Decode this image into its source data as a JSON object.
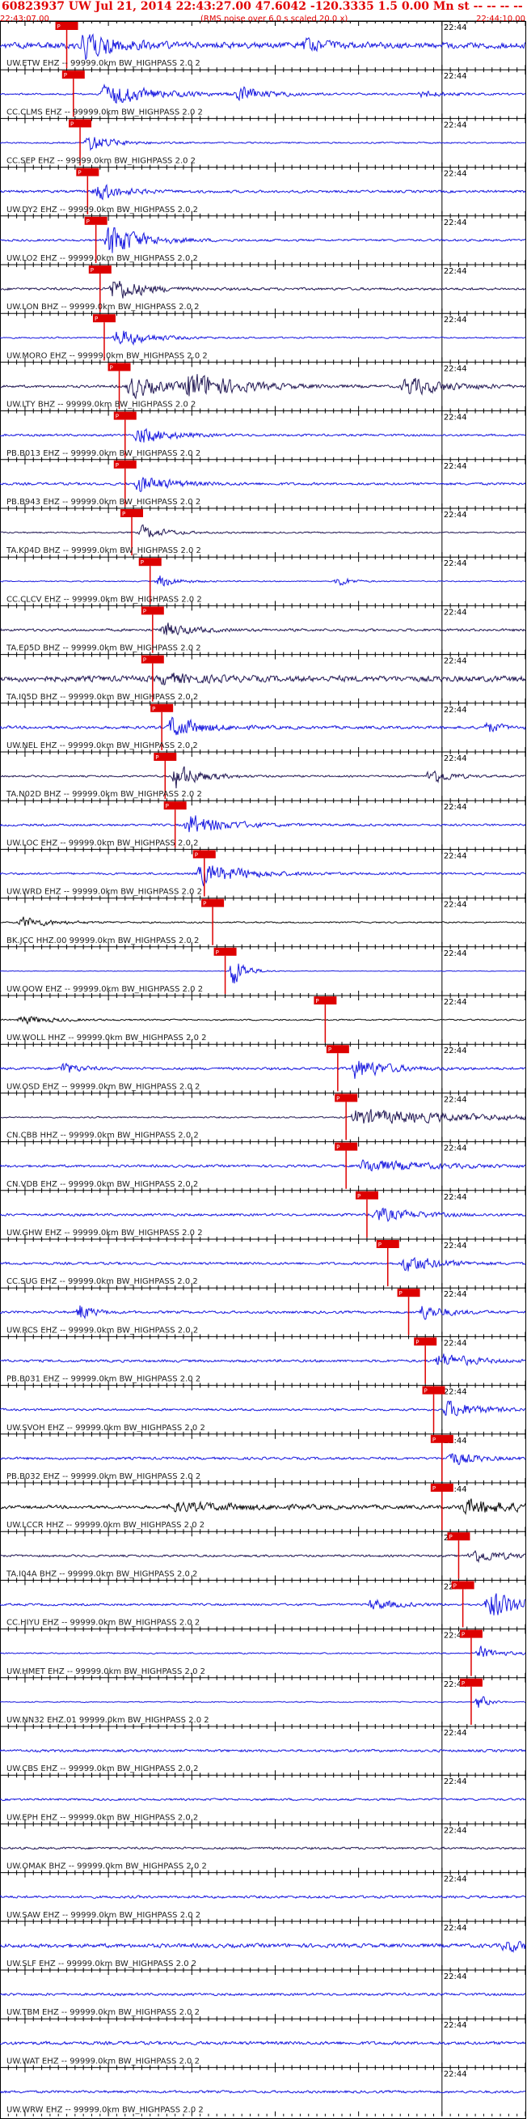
{
  "header": {
    "title": "60823937 UW Jul 21, 2014 22:43:27.00   47.6042 -120.3335  1.5 0.00 Mn st -- -- -- --",
    "start_time": "22:43:07.00",
    "note": "(RMS noise over 6.0 s scaled 20.0 x)",
    "end_time": "22:44:10.00"
  },
  "colors": {
    "header": "#e00000",
    "pick": "#dd0000",
    "blue": "#1a1adf",
    "black": "#111111",
    "navy": "#241a55"
  },
  "chart_data": {
    "type": "line",
    "title": "60823937 UW Jul 21, 2014 22:43:27.00   47.6042 -120.3335  1.5 0.00 Mn st -- -- -- --",
    "x_range_seconds": [
      0,
      63
    ],
    "time_marker": {
      "label": "22:44",
      "seconds": 53
    },
    "traces": [
      {
        "label": "UW.ETW EHZ -- 99999.0km BW_HIGHPASS  2.0  2",
        "color": "blue",
        "amp": 0.85,
        "pick": "P",
        "pick_seconds": 8.0,
        "events": [
          [
            9.5,
            4.5,
            9,
            10
          ],
          [
            36,
            1.2,
            7,
            4
          ]
        ]
      },
      {
        "label": "CC.CLMS EHZ -- 99999.0km BW_HIGHPASS  2.0  2",
        "color": "blue",
        "amp": 0.25,
        "pick": "P",
        "pick_seconds": 8.8,
        "events": [
          [
            12,
            3.5,
            14,
            9
          ],
          [
            28,
            2,
            9,
            10
          ],
          [
            50,
            1,
            8,
            6
          ]
        ]
      },
      {
        "label": "CC.SEP EHZ -- 99999.0km BW_HIGHPASS  2.0  2",
        "color": "blue",
        "amp": 0.2,
        "pick": "P",
        "pick_seconds": 9.6,
        "events": [
          [
            10,
            2.5,
            8,
            6
          ]
        ]
      },
      {
        "label": "UW.DY2 EHZ -- 99999.0km BW_HIGHPASS  2.0  2",
        "color": "blue",
        "amp": 0.35,
        "pick": "P",
        "pick_seconds": 10.5,
        "events": [
          [
            11,
            2.6,
            8,
            6
          ]
        ]
      },
      {
        "label": "UW.LO2 EHZ -- 99999.0km BW_HIGHPASS  2.0  2",
        "color": "blue",
        "amp": 0.3,
        "pick": "P",
        "pick_seconds": 11.5,
        "events": [
          [
            12.5,
            5,
            10,
            8
          ]
        ]
      },
      {
        "label": "UW.LON BHZ -- 99999.0km BW_HIGHPASS  2.0  2",
        "color": "navy",
        "amp": 0.35,
        "pick": "P",
        "pick_seconds": 12.0,
        "events": [
          [
            13,
            3.5,
            9,
            7
          ]
        ]
      },
      {
        "label": "UW.MORO EHZ -- 99999.0km BW_HIGHPASS  2.0  2",
        "color": "blue",
        "amp": 0.2,
        "pick": "P",
        "pick_seconds": 12.5,
        "events": [
          [
            13.5,
            2.6,
            10,
            8
          ]
        ]
      },
      {
        "label": "UW.LTY BHZ -- 99999.0km BW_HIGHPASS  2.0  2",
        "color": "navy",
        "amp": 0.35,
        "pick": "P",
        "pick_seconds": 14.3,
        "events": [
          [
            15,
            3,
            12,
            8
          ],
          [
            22,
            3.6,
            16,
            10
          ],
          [
            48,
            2.5,
            14,
            9
          ]
        ]
      },
      {
        "label": "PB.B013 EHZ -- 99999.0km BW_HIGHPASS  2.0  2",
        "color": "blue",
        "amp": 0.3,
        "pick": "P",
        "pick_seconds": 15.0,
        "events": [
          [
            16,
            2.5,
            10,
            8
          ]
        ]
      },
      {
        "label": "PB.B943 EHZ -- 99999.0km BW_HIGHPASS  2.0  2",
        "color": "blue",
        "amp": 0.35,
        "pick": "P",
        "pick_seconds": 15.0,
        "events": [
          [
            16,
            2.4,
            10,
            8
          ]
        ]
      },
      {
        "label": "TA.K04D BHZ -- 99999.0km BW_HIGHPASS  2.0  2",
        "color": "navy",
        "amp": 0.2,
        "pick": "P",
        "pick_seconds": 15.8,
        "events": [
          [
            16.5,
            1.8,
            8,
            6
          ]
        ]
      },
      {
        "label": "CC.CLCV EHZ -- 99999.0km BW_HIGHPASS  2.0  2",
        "color": "blue",
        "amp": 0.15,
        "pick": "P",
        "pick_seconds": 18.0,
        "events": [
          [
            18.5,
            1.8,
            6,
            5
          ],
          [
            40,
            1.5,
            4,
            4
          ]
        ]
      },
      {
        "label": "TA.E05D BHZ -- 99999.0km BW_HIGHPASS  2.0  2",
        "color": "navy",
        "amp": 0.35,
        "pick": "P",
        "pick_seconds": 18.3,
        "events": [
          [
            19,
            2,
            9,
            6
          ]
        ]
      },
      {
        "label": "TA.I05D BHZ -- 99999.0km BW_HIGHPASS  2.0  2",
        "color": "navy",
        "amp": 0.8,
        "pick": "P",
        "pick_seconds": 18.3,
        "events": [
          [
            19,
            1.3,
            12,
            8
          ]
        ]
      },
      {
        "label": "UW.NEL EHZ -- 99999.0km BW_HIGHPASS  2.0  2",
        "color": "blue",
        "amp": 0.4,
        "pick": "P",
        "pick_seconds": 19.4,
        "events": [
          [
            20,
            3,
            10,
            8
          ],
          [
            58,
            1.6,
            4,
            4
          ]
        ]
      },
      {
        "label": "TA.N02D BHZ -- 99999.0km BW_HIGHPASS  2.0  2",
        "color": "navy",
        "amp": 0.25,
        "pick": "P",
        "pick_seconds": 19.8,
        "events": [
          [
            20.5,
            3.5,
            8,
            6
          ],
          [
            51,
            2.5,
            6,
            5
          ]
        ]
      },
      {
        "label": "UW.LOC EHZ -- 99999.0km BW_HIGHPASS  2.0  2",
        "color": "blue",
        "amp": 0.3,
        "pick": "P",
        "pick_seconds": 21.0,
        "events": [
          [
            22,
            3,
            12,
            8
          ]
        ]
      },
      {
        "label": "UW.WRD EHZ -- 99999.0km BW_HIGHPASS  2.0  2",
        "color": "blue",
        "amp": 0.3,
        "pick": "P",
        "pick_seconds": 24.5,
        "events": [
          [
            23.5,
            3,
            14,
            9
          ]
        ]
      },
      {
        "label": "BK.JCC HHZ.00 99999.0km BW_HIGHPASS  2.0  2",
        "color": "black",
        "amp": 0.2,
        "pick": "P",
        "pick_seconds": 25.5,
        "events": [
          [
            2,
            1.5,
            10,
            6
          ]
        ]
      },
      {
        "label": "UW.OOW EHZ -- 99999.0km BW_HIGHPASS  2.0  2",
        "color": "blue",
        "amp": 0.08,
        "pick": "P",
        "pick_seconds": 27.0,
        "events": [
          [
            27.3,
            5,
            4,
            3
          ]
        ]
      },
      {
        "label": "UW.WOLL HHZ -- 99999.0km BW_HIGHPASS  2.0  2",
        "color": "black",
        "amp": 0.2,
        "pick": "P",
        "pick_seconds": 39.0,
        "events": [
          [
            2,
            1.2,
            10,
            6
          ]
        ]
      },
      {
        "label": "UW.OSD EHZ -- 99999.0km BW_HIGHPASS  2.0  2",
        "color": "blue",
        "amp": 0.35,
        "pick": "P",
        "pick_seconds": 40.5,
        "events": [
          [
            42,
            3,
            10,
            8
          ],
          [
            7,
            1.8,
            5,
            4
          ]
        ]
      },
      {
        "label": "CN.CBB HHZ -- 99999.0km BW_HIGHPASS  2.0  2",
        "color": "navy",
        "amp": 0.2,
        "pick": "P",
        "pick_seconds": 41.5,
        "events": [
          [
            42,
            2.2,
            40,
            10
          ]
        ]
      },
      {
        "label": "CN.VDB EHZ -- 99999.0km BW_HIGHPASS  2.0  2",
        "color": "blue",
        "amp": 0.35,
        "pick": "P",
        "pick_seconds": 41.5,
        "events": [
          [
            43,
            1.8,
            20,
            10
          ]
        ]
      },
      {
        "label": "UW.GHW EHZ -- 99999.0km BW_HIGHPASS  2.0  2",
        "color": "blue",
        "amp": 0.35,
        "pick": "P",
        "pick_seconds": 44.0,
        "events": [
          [
            44.5,
            2,
            12,
            8
          ]
        ]
      },
      {
        "label": "CC.SUG EHZ -- 99999.0km BW_HIGHPASS  2.0  2",
        "color": "blue",
        "amp": 0.35,
        "pick": "P",
        "pick_seconds": 46.5,
        "events": [
          [
            48,
            2.5,
            10,
            8
          ]
        ]
      },
      {
        "label": "UW.RCS EHZ -- 99999.0km BW_HIGHPASS  2.0  2",
        "color": "blue",
        "amp": 0.35,
        "pick": "P",
        "pick_seconds": 49.0,
        "events": [
          [
            50,
            2,
            8,
            6
          ],
          [
            9,
            2.6,
            4,
            3
          ]
        ]
      },
      {
        "label": "PB.B031 EHZ -- 99999.0km BW_HIGHPASS  2.0  2",
        "color": "blue",
        "amp": 0.35,
        "pick": "P",
        "pick_seconds": 51.0,
        "events": [
          [
            52,
            2.2,
            10,
            8
          ]
        ]
      },
      {
        "label": "UW.SVOH EHZ -- 99999.0km BW_HIGHPASS  2.0  2",
        "color": "blue",
        "amp": 0.3,
        "pick": "P",
        "pick_seconds": 52.0,
        "events": [
          [
            53,
            2.5,
            10,
            8
          ]
        ]
      },
      {
        "label": "PB.B032 EHZ -- 99999.0km BW_HIGHPASS  2.0  2",
        "color": "blue",
        "amp": 0.35,
        "pick": "P",
        "pick_seconds": 53.0,
        "events": [
          [
            53.5,
            2,
            8,
            6
          ]
        ]
      },
      {
        "label": "UW.LCCR HHZ -- 99999.0km BW_HIGHPASS  2.0  2",
        "color": "black",
        "amp": 0.45,
        "pick": "P",
        "pick_seconds": 53.0,
        "events": [
          [
            55,
            2,
            20,
            10
          ],
          [
            20,
            1.2,
            30,
            10
          ]
        ]
      },
      {
        "label": "TA.I04A BHZ -- 99999.0km BW_HIGHPASS  2.0  2",
        "color": "navy",
        "amp": 0.3,
        "pick": "P",
        "pick_seconds": 55.0,
        "events": [
          [
            56,
            2,
            10,
            8
          ]
        ]
      },
      {
        "label": "CC.HIYU EHZ -- 99999.0km BW_HIGHPASS  2.0  2",
        "color": "blue",
        "amp": 0.3,
        "pick": "P",
        "pick_seconds": 55.5,
        "events": [
          [
            58,
            4,
            12,
            10
          ],
          [
            44,
            1.6,
            8,
            6
          ]
        ]
      },
      {
        "label": "UW.HMET EHZ -- 99999.0km BW_HIGHPASS  2.0  2",
        "color": "blue",
        "amp": 0.2,
        "pick": "P",
        "pick_seconds": 56.5,
        "events": [
          [
            57,
            1.8,
            6,
            5
          ]
        ]
      },
      {
        "label": "UW.NN32 EHZ.01 99999.0km BW_HIGHPASS  2.0  2",
        "color": "blue",
        "amp": 0.15,
        "pick": "P",
        "pick_seconds": 56.5,
        "events": [
          [
            56.8,
            2.2,
            3,
            3
          ]
        ]
      },
      {
        "label": "UW.CBS EHZ -- 99999.0km BW_HIGHPASS  2.0  2",
        "color": "blue",
        "amp": 0.35,
        "events": []
      },
      {
        "label": "UW.EPH EHZ -- 99999.0km BW_HIGHPASS  2.0  2",
        "color": "blue",
        "amp": 0.3,
        "events": []
      },
      {
        "label": "UW.OMAK BHZ -- 99999.0km BW_HIGHPASS  2.0  2",
        "color": "navy",
        "amp": 0.3,
        "events": []
      },
      {
        "label": "UW.SAW EHZ -- 99999.0km BW_HIGHPASS  2.0  2",
        "color": "blue",
        "amp": 0.35,
        "events": []
      },
      {
        "label": "UW.SLF EHZ -- 99999.0km BW_HIGHPASS  2.0  2",
        "color": "blue",
        "amp": 0.55,
        "events": [
          [
            60,
            1.4,
            10,
            6
          ]
        ]
      },
      {
        "label": "UW.TBM EHZ -- 99999.0km BW_HIGHPASS  2.0  2",
        "color": "blue",
        "amp": 0.35,
        "events": []
      },
      {
        "label": "UW.WAT EHZ -- 99999.0km BW_HIGHPASS  2.0  2",
        "color": "blue",
        "amp": 0.45,
        "events": []
      },
      {
        "label": "UW.WRW EHZ -- 99999.0km BW_HIGHPASS  2.0  2",
        "color": "blue",
        "amp": 0.35,
        "events": []
      }
    ]
  }
}
